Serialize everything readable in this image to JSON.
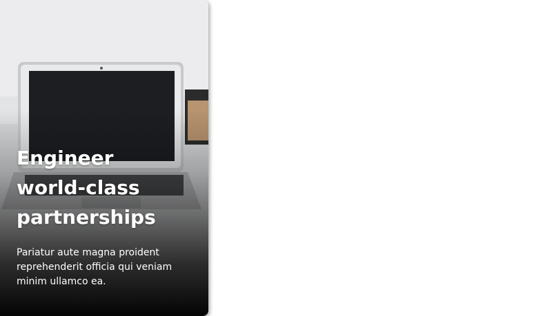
{
  "card": {
    "title": "Engineer world-class partnerships",
    "description": "Pariatur aute magna proident reprehenderit officia qui veniam minim ullamco ea.",
    "image_icon": "laptop-photo"
  },
  "colors": {
    "text": "#ffffff",
    "overlay": "#000000",
    "background": "#ffffff"
  }
}
